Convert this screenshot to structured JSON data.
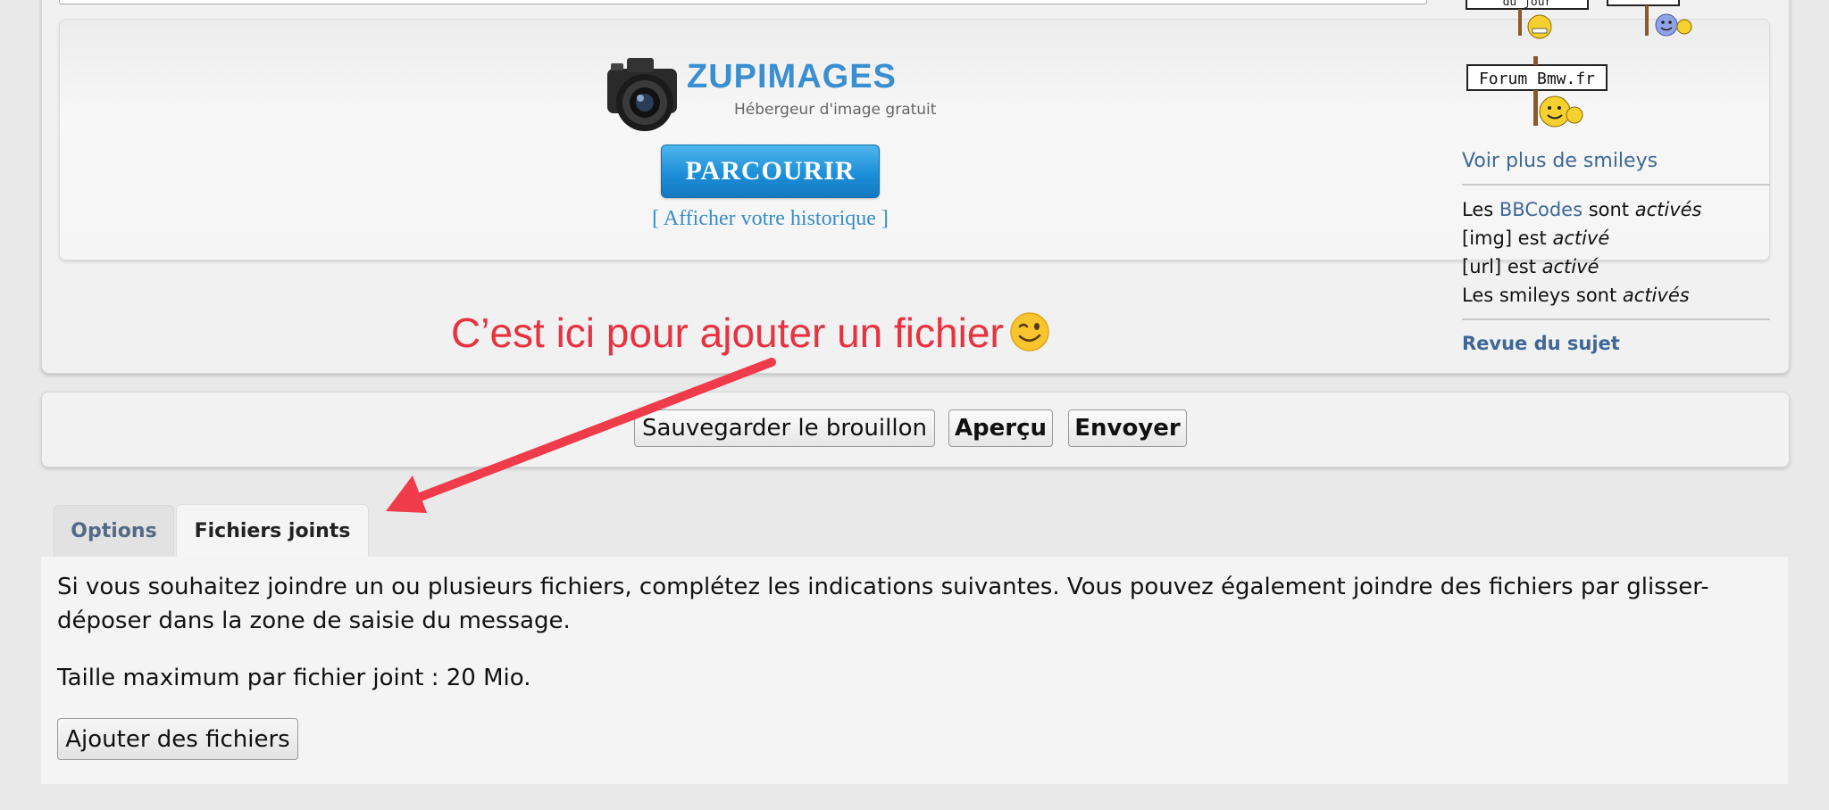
{
  "uploader": {
    "brand_name": "ZUPIMAGES",
    "tagline": "Hébergeur d'image gratuit",
    "browse_label": "PARCOURIR",
    "history_link": "[ Afficher votre historique ]"
  },
  "sidebar": {
    "smiley_sign_top_left": "du jour",
    "smiley_sign_forum": "Forum Bmw.fr",
    "more_smileys": "Voir plus de smileys",
    "bbcodes": {
      "prefix": "Les ",
      "link": "BBCodes",
      "mid": " sont ",
      "state": "activés"
    },
    "img": {
      "label": "[img] est ",
      "state": "activé"
    },
    "url": {
      "label": "[url] est ",
      "state": "activé"
    },
    "smileys": {
      "label": "Les smileys sont ",
      "state": "activés"
    },
    "review_topic": "Revue du sujet"
  },
  "annotation": {
    "text": "C’est ici pour ajouter un fichier",
    "color": "#e8323f",
    "icon": "winking-face-emoji"
  },
  "actions": {
    "save_draft": "Sauvegarder le brouillon",
    "preview": "Aperçu",
    "send": "Envoyer"
  },
  "tabs": [
    {
      "label": "Options",
      "active": false
    },
    {
      "label": "Fichiers joints",
      "active": true
    }
  ],
  "attachments": {
    "instructions_line1": "Si vous souhaitez joindre un ou plusieurs fichiers, complétez les indications suivantes. Vous pouvez également joindre des fichiers par glisser-",
    "instructions_line2": "déposer dans la zone de saisie du message.",
    "max_size": "Taille maximum par fichier joint : 20 Mio.",
    "add_files": "Ajouter des fichiers"
  },
  "colors": {
    "link": "#3e6797",
    "accent_blue": "#1d8fd8",
    "annotation_red": "#e8323f"
  }
}
